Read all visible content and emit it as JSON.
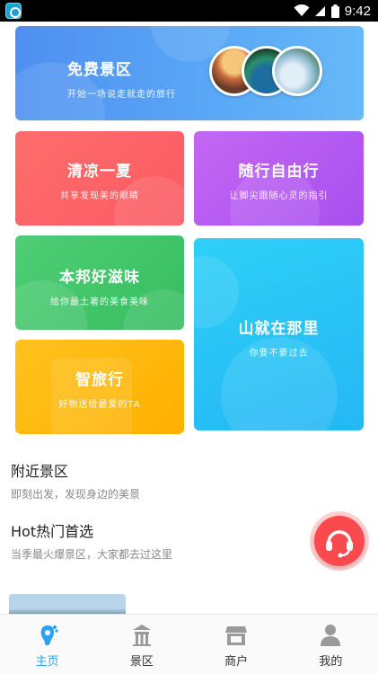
{
  "status_bar": {
    "time": "9:42"
  },
  "cards": {
    "free": {
      "title": "免费景区",
      "subtitle": "开始一场说走就走的旅行"
    },
    "cool": {
      "title": "清凉一夏",
      "subtitle": "共享发现美的眼睛"
    },
    "travel": {
      "title": "随行自由行",
      "subtitle": "让脚尖跟随心灵的指引"
    },
    "food": {
      "title": "本邦好滋味",
      "subtitle": "给你最土著的美食美味"
    },
    "smart": {
      "title": "智旅行",
      "subtitle": "好物送给最爱的TA"
    },
    "mountain": {
      "title": "山就在那里",
      "subtitle": "你要不要过去"
    }
  },
  "sections": {
    "nearby": {
      "title": "附近景区",
      "desc": "即刻出发，发现身边的美景"
    },
    "hot": {
      "title": "Hot热门首选",
      "desc": "当季最火爆景区，大家都去过这里"
    }
  },
  "tabs": [
    {
      "label": "主页",
      "icon": "footprint-icon",
      "active": true
    },
    {
      "label": "景区",
      "icon": "gate-icon",
      "active": false
    },
    {
      "label": "商户",
      "icon": "store-icon",
      "active": false
    },
    {
      "label": "我的",
      "icon": "person-icon",
      "active": false
    }
  ],
  "colors": {
    "accent": "#2aa2f0",
    "free_card": "#5aa9f7",
    "cool_card": "#fa5a63",
    "travel_card": "#b55bf1",
    "food_card": "#3fc46a",
    "smart_card": "#ffb80e",
    "mountain_card": "#29c3f5",
    "fab": "#fa4a4e"
  }
}
